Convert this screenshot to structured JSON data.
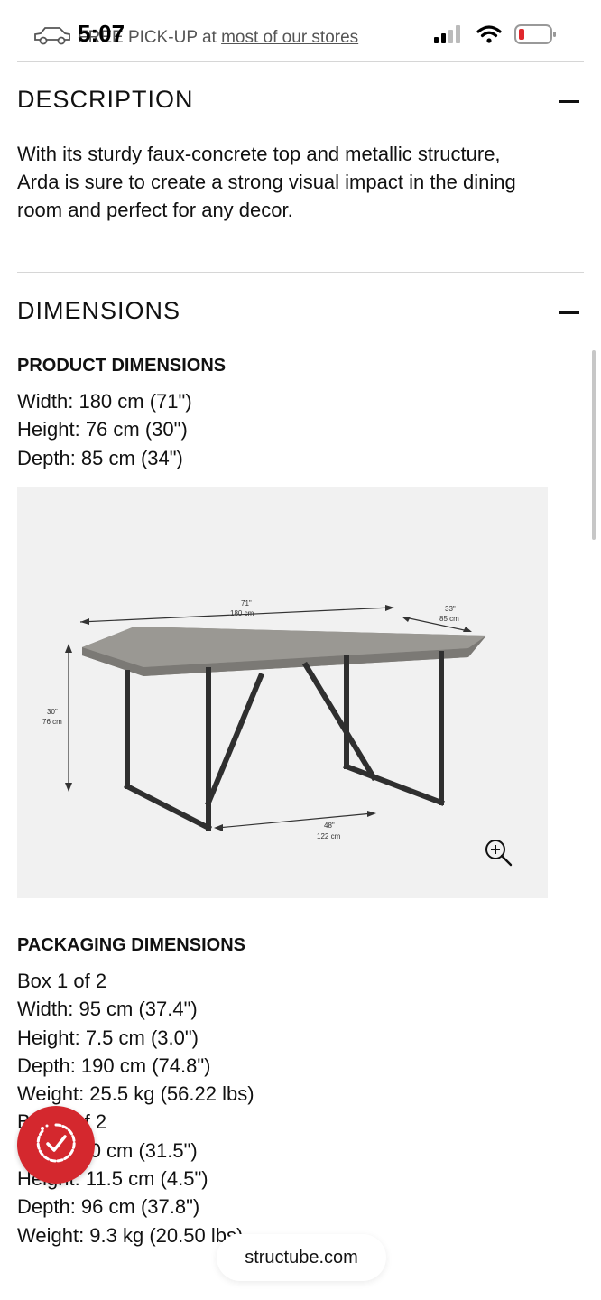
{
  "status_bar": {
    "time": "5:07",
    "promo_text": "FREE PICK-UP",
    "promo_at": "at",
    "promo_link": "most of our stores"
  },
  "description": {
    "title": "DESCRIPTION",
    "body": "With its sturdy faux-concrete top and metallic structure, Arda is sure to create a strong visual impact in the dining room and perfect for any decor."
  },
  "dimensions": {
    "title": "DIMENSIONS",
    "product": {
      "title": "PRODUCT DIMENSIONS",
      "lines": [
        "Width: 180 cm (71\")",
        "Height: 76 cm (30\")",
        "Depth: 85 cm (34\")"
      ]
    },
    "diagram_labels": {
      "width_in": "71\"",
      "width_cm": "180 cm",
      "depth_in": "33\"",
      "depth_cm": "85 cm",
      "height_in": "30\"",
      "height_cm": "76 cm",
      "base_in": "48\"",
      "base_cm": "122 cm"
    },
    "packaging": {
      "title": "PACKAGING DIMENSIONS",
      "lines": [
        "Box 1 of 2",
        "Width: 95 cm (37.4\")",
        "Height: 7.5 cm (3.0\")",
        "Depth: 190 cm (74.8\")",
        "Weight: 25.5 kg (56.22 lbs)",
        "Box 2 of 2",
        "Width: 80 cm (31.5\")",
        "Height: 11.5 cm (4.5\")",
        "Depth: 96 cm (37.8\")",
        "Weight: 9.3 kg (20.50 lbs)"
      ]
    }
  },
  "browser": {
    "url": "structube.com"
  },
  "icons": {
    "car": "car-icon",
    "signal": "signal-icon",
    "wifi": "wifi-icon",
    "battery": "battery-icon",
    "zoom": "zoom-in-icon",
    "fab": "check-badge-icon"
  },
  "colors": {
    "accent_red": "#d4282e",
    "image_bg": "#f1f1f1",
    "divider": "#d6d6d6"
  }
}
